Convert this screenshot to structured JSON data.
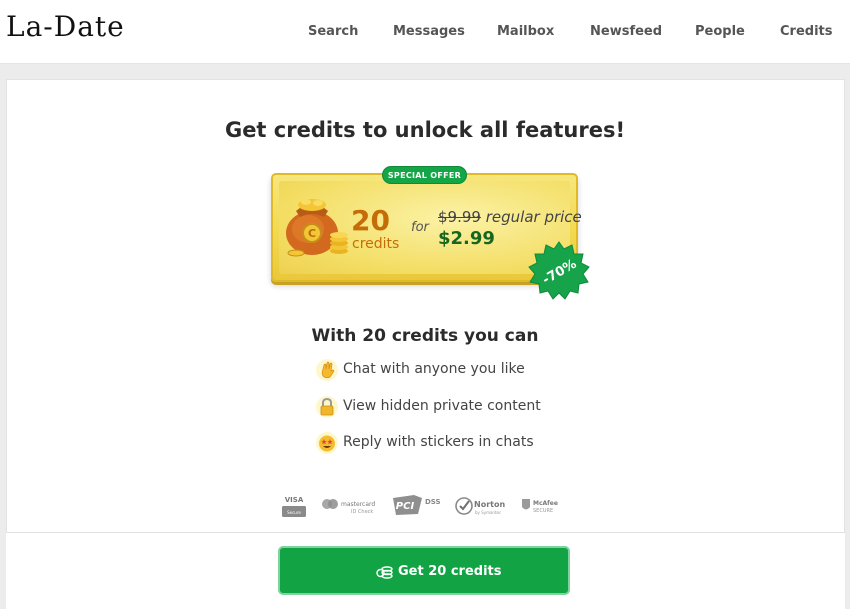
{
  "header": {
    "logo": "La-Date",
    "nav": [
      "Search",
      "Messages",
      "Mailbox",
      "Newsfeed",
      "People",
      "Credits"
    ]
  },
  "main": {
    "title": "Get credits to unlock all features!",
    "offer": {
      "badge": "SPECIAL OFFER",
      "amount": "20",
      "unit": "credits",
      "for": "for",
      "old_price": "$9.99",
      "old_price_suffix": " regular price",
      "new_price": "$2.99",
      "discount": "-70%",
      "icon": "money-bag-icon"
    },
    "benefits_title": "With 20 credits you can",
    "benefits": [
      {
        "icon": "waving-hand-icon",
        "text": "Chat with anyone you like"
      },
      {
        "icon": "lock-icon",
        "text": "View hidden private content"
      },
      {
        "icon": "star-struck-face-icon",
        "text": "Reply with stickers in chats"
      }
    ],
    "trust_badges": [
      {
        "name": "visa-secure-icon",
        "label": "VISA",
        "sub": "Secure"
      },
      {
        "name": "mastercard-id-check-icon",
        "label": "mastercard",
        "sub": "ID Check"
      },
      {
        "name": "pci-dss-icon",
        "label": "PCI",
        "sub": "DSS"
      },
      {
        "name": "norton-icon",
        "label": "Norton",
        "sub": "by Symantec"
      },
      {
        "name": "mcafee-secure-icon",
        "label": "McAfee",
        "sub": "SECURE"
      }
    ]
  },
  "cta": {
    "label": "Get 20 credits",
    "icon": "coins-icon"
  },
  "colors": {
    "accent_green": "#12a444",
    "gold": "#f3d950",
    "credit_orange": "#c46d07",
    "price_green": "#17661f"
  }
}
